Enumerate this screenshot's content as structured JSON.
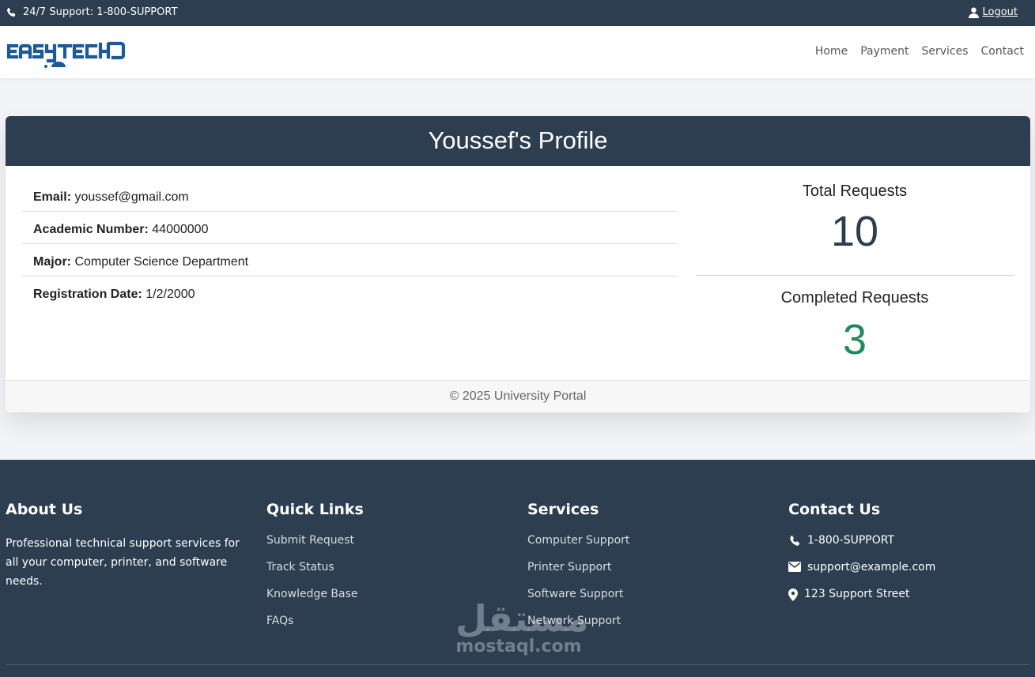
{
  "topbar": {
    "support_text": "24/7 Support: 1-800-SUPPORT",
    "logout_label": "Logout"
  },
  "brand": {
    "logo_text": "EASYTECH"
  },
  "nav": {
    "items": [
      "Home",
      "Payment",
      "Services",
      "Contact"
    ]
  },
  "profile": {
    "title": "Youssef's Profile",
    "fields": [
      {
        "label": "Email:",
        "value": "youssef@gmail.com"
      },
      {
        "label": "Academic Number:",
        "value": "44000000"
      },
      {
        "label": "Major:",
        "value": "Computer Science Department"
      },
      {
        "label": "Registration Date:",
        "value": "1/2/2000"
      }
    ],
    "stats": {
      "total_label": "Total Requests",
      "total_value": "10",
      "completed_label": "Completed Requests",
      "completed_value": "3"
    },
    "footer_text": "© 2025 University Portal"
  },
  "footer": {
    "about": {
      "heading": "About Us",
      "text": "Professional technical support services for all your computer, printer, and software needs."
    },
    "quick_links": {
      "heading": "Quick Links",
      "items": [
        "Submit Request",
        "Track Status",
        "Knowledge Base",
        "FAQs"
      ]
    },
    "services": {
      "heading": "Services",
      "items": [
        "Computer Support",
        "Printer Support",
        "Software Support",
        "Network Support"
      ]
    },
    "contact": {
      "heading": "Contact Us",
      "phone": "1-800-SUPPORT",
      "email": "support@example.com",
      "address": "123 Support Street"
    }
  },
  "watermark": {
    "arabic": "مستقل",
    "latin": "mostaql.com"
  },
  "colors": {
    "primary": "#2c3e50",
    "completed": "#1f8a5b",
    "logo_blue": "#1d5a9a"
  }
}
